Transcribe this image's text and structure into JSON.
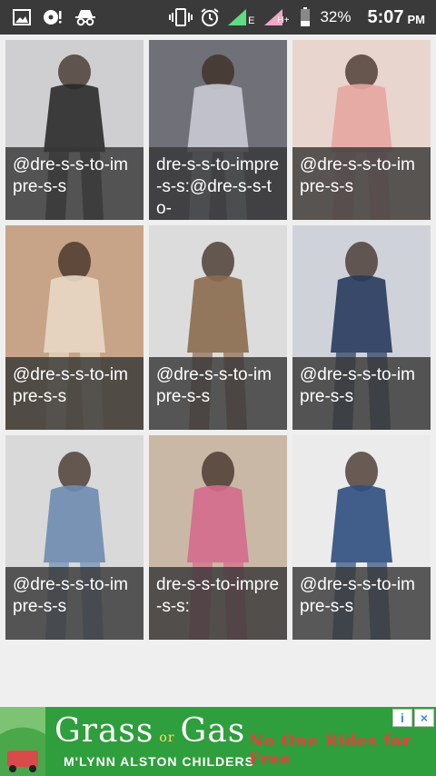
{
  "status_bar": {
    "left_icons": [
      "gallery-icon",
      "music-alert-icon",
      "incognito-icon"
    ],
    "right_icons": [
      "vibrate-icon",
      "alarm-icon",
      "signal-icon",
      "signal-data-icon",
      "battery-icon"
    ],
    "network_label_1": "E",
    "network_label_2": "H+",
    "battery_percent": "32%",
    "time": "5:07",
    "ampm": "PM"
  },
  "grid": {
    "tiles": [
      {
        "caption": "@dre-s-s-to-impre-s-s",
        "bg": "#cfcfd1",
        "fg": "#2a2a2a"
      },
      {
        "caption": "dre-s-s-to-impre-s-s:@dre-s-s-to-",
        "bg": "#6f7078",
        "fg": "#c9cad3"
      },
      {
        "caption": "@dre-s-s-to-impre-s-s",
        "bg": "#e8d5cd",
        "fg": "#e7a6a2"
      },
      {
        "caption": "@dre-s-s-to-impre-s-s",
        "bg": "#c7a487",
        "fg": "#e8d8c6"
      },
      {
        "caption": "@dre-s-s-to-impre-s-s",
        "bg": "#dcdcdc",
        "fg": "#8b6b4f"
      },
      {
        "caption": "@dre-s-s-to-impre-s-s",
        "bg": "#cfd3d9",
        "fg": "#273a5c"
      },
      {
        "caption": "@dre-s-s-to-impre-s-s",
        "bg": "#d9d9d9",
        "fg": "#6e8bb0"
      },
      {
        "caption": "dre-s-s-to-impre-s-s:",
        "bg": "#c9b8a6",
        "fg": "#d46b8d"
      },
      {
        "caption": "@dre-s-s-to-impre-s-s",
        "bg": "#ebebeb",
        "fg": "#2f4e80"
      }
    ]
  },
  "ad": {
    "title_left": "Grass",
    "title_or": "or",
    "title_right": "Gas",
    "subtitle": "M'LYNN ALSTON CHILDERS",
    "tagline": "No One Rides for Free",
    "info_label": "i",
    "close_label": "×",
    "colors": {
      "background": "#2f9e3c",
      "tagline": "#f03b3b"
    }
  }
}
